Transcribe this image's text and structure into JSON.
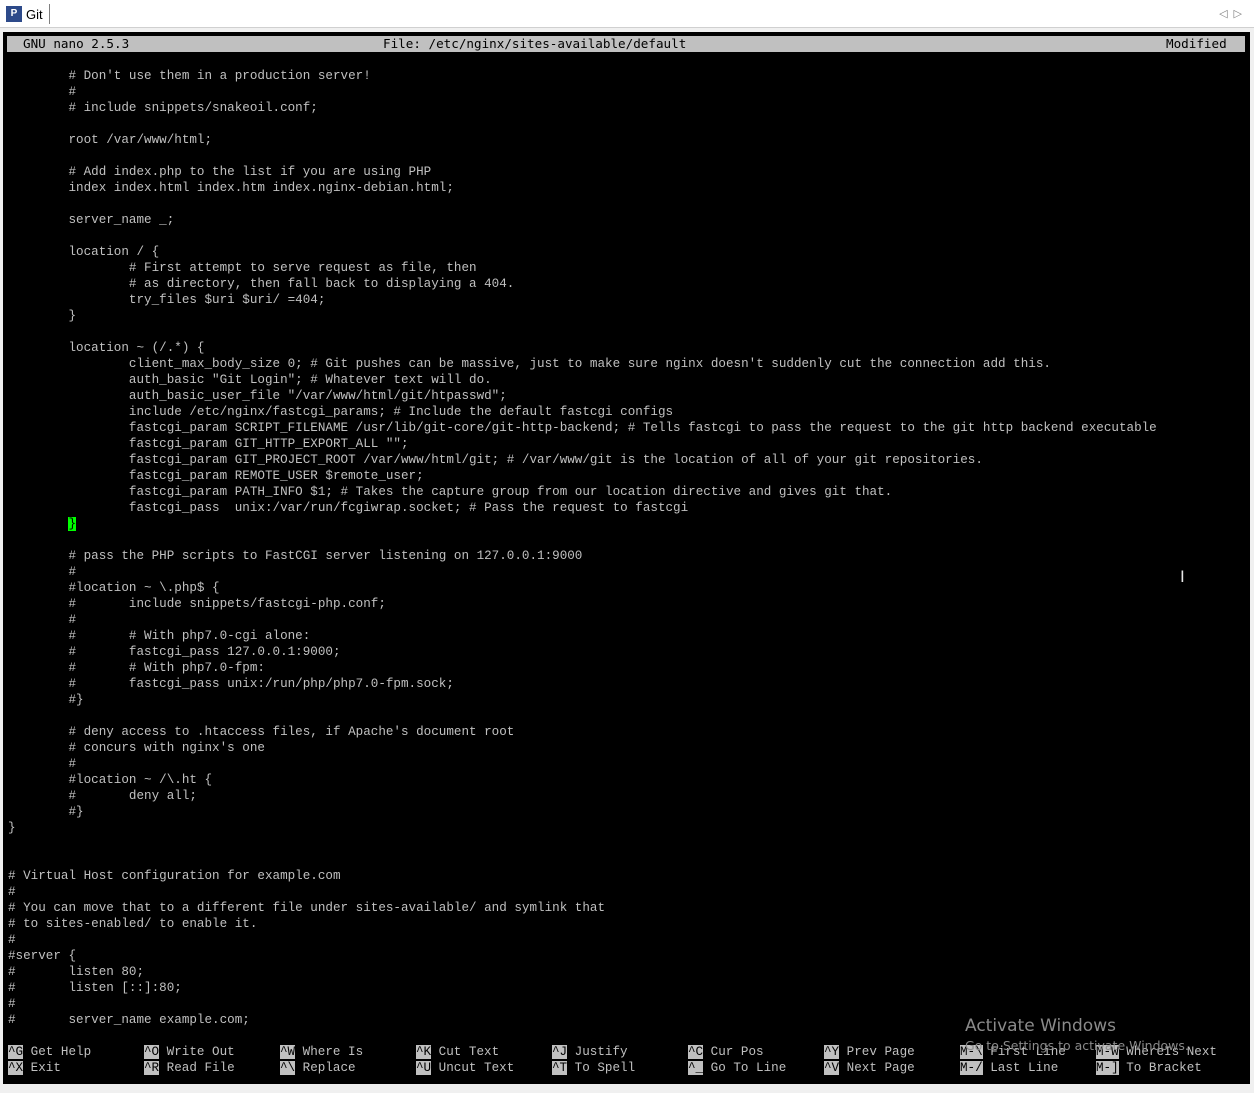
{
  "window": {
    "tab_title": "Git",
    "tab_icon": "putty-icon"
  },
  "nano": {
    "version": "GNU nano 2.5.3",
    "file": "File: /etc/nginx/sites-available/default",
    "status": "Modified"
  },
  "lines": [
    "        # Don't use them in a production server!",
    "        #",
    "        # include snippets/snakeoil.conf;",
    "",
    "        root /var/www/html;",
    "",
    "        # Add index.php to the list if you are using PHP",
    "        index index.html index.htm index.nginx-debian.html;",
    "",
    "        server_name _;",
    "",
    "        location / {",
    "                # First attempt to serve request as file, then",
    "                # as directory, then fall back to displaying a 404.",
    "                try_files $uri $uri/ =404;",
    "        }",
    "",
    "        location ~ (/.*) {",
    "                client_max_body_size 0; # Git pushes can be massive, just to make sure nginx doesn't suddenly cut the connection add this.",
    "                auth_basic \"Git Login\"; # Whatever text will do.",
    "                auth_basic_user_file \"/var/www/html/git/htpasswd\";",
    "                include /etc/nginx/fastcgi_params; # Include the default fastcgi configs",
    "                fastcgi_param SCRIPT_FILENAME /usr/lib/git-core/git-http-backend; # Tells fastcgi to pass the request to the git http backend executable",
    "                fastcgi_param GIT_HTTP_EXPORT_ALL \"\";",
    "                fastcgi_param GIT_PROJECT_ROOT /var/www/html/git; # /var/www/git is the location of all of your git repositories.",
    "                fastcgi_param REMOTE_USER $remote_user;",
    "                fastcgi_param PATH_INFO $1; # Takes the capture group from our location directive and gives git that.",
    "                fastcgi_pass  unix:/var/run/fcgiwrap.socket; # Pass the request to fastcgi",
    "        }",
    "",
    "        # pass the PHP scripts to FastCGI server listening on 127.0.0.1:9000",
    "        #",
    "        #location ~ \\.php$ {",
    "        #       include snippets/fastcgi-php.conf;",
    "        #",
    "        #       # With php7.0-cgi alone:",
    "        #       fastcgi_pass 127.0.0.1:9000;",
    "        #       # With php7.0-fpm:",
    "        #       fastcgi_pass unix:/run/php/php7.0-fpm.sock;",
    "        #}",
    "",
    "        # deny access to .htaccess files, if Apache's document root",
    "        # concurs with nginx's one",
    "        #",
    "        #location ~ /\\.ht {",
    "        #       deny all;",
    "        #}",
    "}",
    "",
    "",
    "# Virtual Host configuration for example.com",
    "#",
    "# You can move that to a different file under sites-available/ and symlink that",
    "# to sites-enabled/ to enable it.",
    "#",
    "#server {",
    "#       listen 80;",
    "#       listen [::]:80;",
    "#",
    "#       server_name example.com;"
  ],
  "shortcuts": [
    [
      {
        "key": "^G",
        "label": "Get Help"
      },
      {
        "key": "^X",
        "label": "Exit"
      }
    ],
    [
      {
        "key": "^O",
        "label": "Write Out"
      },
      {
        "key": "^R",
        "label": "Read File"
      }
    ],
    [
      {
        "key": "^W",
        "label": "Where Is"
      },
      {
        "key": "^\\",
        "label": "Replace"
      }
    ],
    [
      {
        "key": "^K",
        "label": "Cut Text"
      },
      {
        "key": "^U",
        "label": "Uncut Text"
      }
    ],
    [
      {
        "key": "^J",
        "label": "Justify"
      },
      {
        "key": "^T",
        "label": "To Spell"
      }
    ],
    [
      {
        "key": "^C",
        "label": "Cur Pos"
      },
      {
        "key": "^_",
        "label": "Go To Line"
      }
    ],
    [
      {
        "key": "^Y",
        "label": "Prev Page"
      },
      {
        "key": "^V",
        "label": "Next Page"
      }
    ],
    [
      {
        "key": "M-\\",
        "label": "First Line"
      },
      {
        "key": "M-/",
        "label": "Last Line"
      }
    ],
    [
      {
        "key": "M-W",
        "label": "WhereIs Next"
      },
      {
        "key": "M-]",
        "label": "To Bracket"
      }
    ]
  ],
  "watermark": {
    "title": "Activate Windows",
    "subtitle": "Go to Settings to activate Windows."
  },
  "colors": {
    "background": "#000000",
    "text": "#c0c0c0",
    "titlebar": "#c0c0c0",
    "cursor": "#00ff00"
  }
}
